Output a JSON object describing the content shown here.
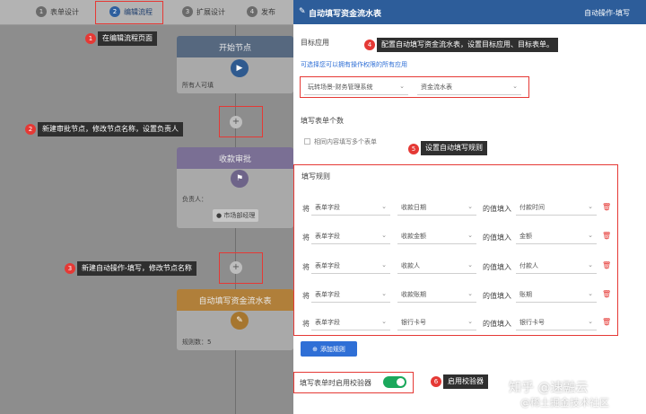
{
  "steps": [
    {
      "num": "1",
      "label": "表单设计"
    },
    {
      "num": "2",
      "label": "编辑流程"
    },
    {
      "num": "3",
      "label": "扩展设计"
    },
    {
      "num": "4",
      "label": "发布"
    }
  ],
  "canvas": {
    "start_node": {
      "title": "开始节点",
      "body": "所有人可填"
    },
    "approval_node": {
      "title": "收款审批",
      "assignee_label": "负责人：",
      "assignee": "市场部经理"
    },
    "auto_node": {
      "title": "自动填写资金流水表",
      "body": "规则数：5"
    }
  },
  "annotations": [
    {
      "num": "1",
      "text": "在编辑流程页面"
    },
    {
      "num": "2",
      "text": "新建审批节点，修改节点名称，设置负责人"
    },
    {
      "num": "3",
      "text": "新建自动操作-填写，修改节点名称"
    },
    {
      "num": "4",
      "text": "配置自动填写资金流水表，设置目标应用、目标表单。"
    },
    {
      "num": "5",
      "text": "设置自动填写规则"
    },
    {
      "num": "6",
      "text": "启用校验器"
    }
  ],
  "panel": {
    "title": "自动填写资金流水表",
    "type_label": "自动操作-填写",
    "target_app_label": "目标应用",
    "target_app_hint": "可选择您可以拥有操作权限的所有应用",
    "app_select": "玩转场景-财务管理系统",
    "form_select": "资金流水表",
    "fill_count_label": "填写表单个数",
    "same_content_label": "相同内容填写多个表单",
    "rules_label": "填写规则",
    "rule_prefix": "将",
    "rule_mid": "的值填入",
    "rules": [
      {
        "source": "表单字段",
        "field": "收款日期",
        "target": "付款时间"
      },
      {
        "source": "表单字段",
        "field": "收款金额",
        "target": "金额"
      },
      {
        "source": "表单字段",
        "field": "收款人",
        "target": "付款人"
      },
      {
        "source": "表单字段",
        "field": "收款账期",
        "target": "账期"
      },
      {
        "source": "表单字段",
        "field": "银行卡号",
        "target": "银行卡号"
      }
    ],
    "add_rule_label": "添加规则",
    "validator_label": "填写表单时启用校验器"
  },
  "watermark": {
    "line1": "知乎 @速融云",
    "line2": "@稀土掘金技术社区"
  },
  "colors": {
    "header": "#2d5d9a",
    "accent": "#2f6fd6",
    "highlight": "#e53935",
    "toggle_on": "#1aa85c"
  }
}
